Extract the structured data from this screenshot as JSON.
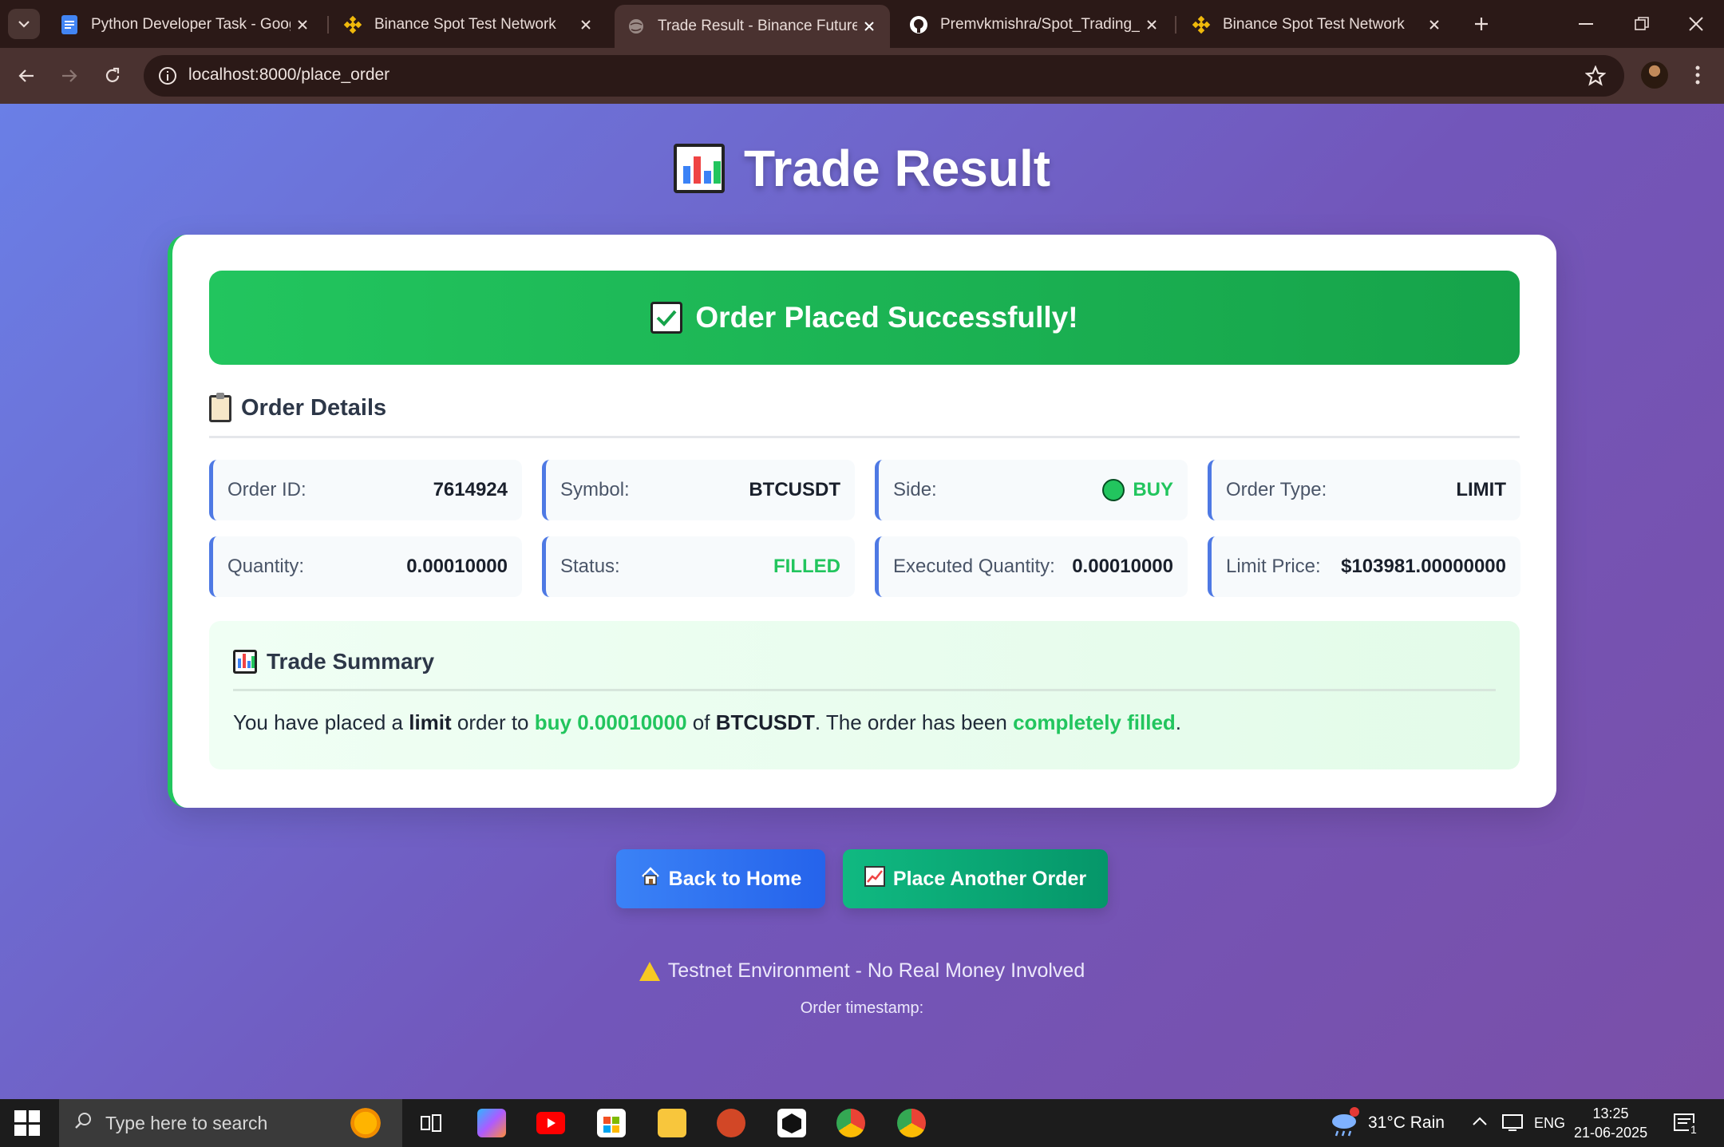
{
  "browser": {
    "tabs": [
      {
        "title": "Python Developer Task - Googl",
        "icon": "google-docs-icon",
        "active": false
      },
      {
        "title": "Binance Spot Test Network",
        "icon": "binance-icon",
        "active": false
      },
      {
        "title": "Trade Result - Binance Futures",
        "icon": "globe-icon",
        "active": true
      },
      {
        "title": "Premvkmishra/Spot_Trading_Bo",
        "icon": "github-icon",
        "active": false
      },
      {
        "title": "Binance Spot Test Network",
        "icon": "binance-icon",
        "active": false
      }
    ],
    "url": "localhost:8000/place_order"
  },
  "page": {
    "title": "Trade Result",
    "success_message": "Order Placed Successfully!",
    "details_heading": "Order Details",
    "details": {
      "order_id": {
        "label": "Order ID:",
        "value": "7614924"
      },
      "symbol": {
        "label": "Symbol:",
        "value": "BTCUSDT"
      },
      "side": {
        "label": "Side:",
        "value": "BUY"
      },
      "order_type": {
        "label": "Order Type:",
        "value": "LIMIT"
      },
      "quantity": {
        "label": "Quantity:",
        "value": "0.00010000"
      },
      "status": {
        "label": "Status:",
        "value": "FILLED"
      },
      "executed_quantity": {
        "label": "Executed Quantity:",
        "value": "0.00010000"
      },
      "limit_price": {
        "label": "Limit Price:",
        "value": "$103981.00000000"
      }
    },
    "summary": {
      "heading": "Trade Summary",
      "t1": "You have placed a ",
      "order_type": "limit",
      "t2": " order to ",
      "side_qty": "buy 0.00010000",
      "t3": " of ",
      "symbol": "BTCUSDT",
      "t4": ". The order has been ",
      "status": "completely filled",
      "t5": "."
    },
    "buttons": {
      "home": "Back to Home",
      "another": "Place Another Order"
    },
    "warning": "Testnet Environment - No Real Money Involved",
    "timestamp_label": "Order timestamp:"
  },
  "taskbar": {
    "search_placeholder": "Type here to search",
    "weather": "31°C  Rain",
    "language": "ENG",
    "time": "13:25",
    "date": "21-06-2025",
    "notification_count": "1"
  },
  "colors": {
    "success": "#22c55e",
    "accent_blue": "#4e79e4",
    "gradient_start": "#6a7fe6",
    "gradient_end": "#7a4fa8"
  }
}
